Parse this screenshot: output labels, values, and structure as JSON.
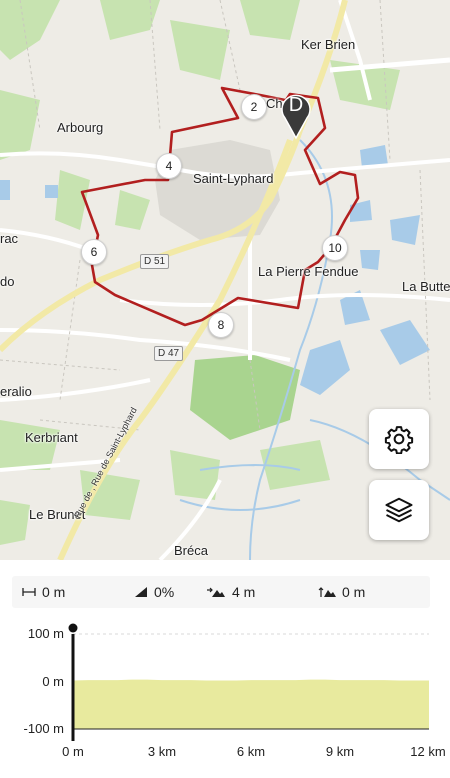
{
  "map": {
    "places": {
      "ker_brien": "Ker Brien",
      "arbourg": "Arbourg",
      "saint_lyphard": "Saint-Lyphard",
      "la_pierre_fendue": "La Pierre Fendue",
      "la_butte": "La Butte",
      "rac": "rac",
      "do": "do",
      "eralio": "eralio",
      "kerbriant": "Kerbriant",
      "le_brunet": "Le Brunet",
      "breca": "Bréca",
      "chapelle_fragment": "Ch"
    },
    "road_labels": {
      "d51": "D 51",
      "d47": "D 47",
      "rue": "Rue de , Rue de Saint-Lyphard"
    },
    "km_markers": [
      "2",
      "4",
      "6",
      "8",
      "10"
    ],
    "start_marker": "D",
    "route_color": "#b21f1f",
    "buttons": {
      "settings_icon": "gear-icon",
      "layers_icon": "layers-icon"
    }
  },
  "stats": {
    "distance": "0 m",
    "slope": "0%",
    "elevation_gain": "4 m",
    "elevation_max": "0 m"
  },
  "chart_data": {
    "type": "area",
    "title": "",
    "xlabel": "",
    "ylabel": "",
    "y_ticks": [
      "100 m",
      "0 m",
      "-100 m"
    ],
    "x_ticks": [
      "0 m",
      "3 km",
      "6 km",
      "9 km",
      "12 km"
    ],
    "ylim": [
      -100,
      100
    ],
    "xlim": [
      0,
      12
    ],
    "x_unit": "km",
    "y_unit": "m",
    "fill_color": "#e8ea9e",
    "x": [
      0,
      0.5,
      1,
      1.5,
      2,
      2.5,
      3,
      3.5,
      4,
      4.5,
      5,
      5.5,
      6,
      6.5,
      7,
      7.5,
      8,
      8.5,
      9,
      9.5,
      10,
      10.5,
      11,
      11.5,
      12
    ],
    "values": [
      2,
      3,
      3,
      3,
      4,
      4,
      3,
      3,
      3,
      2,
      2,
      2,
      3,
      3,
      3,
      3,
      4,
      4,
      3,
      3,
      3,
      3,
      2,
      2,
      2
    ]
  }
}
